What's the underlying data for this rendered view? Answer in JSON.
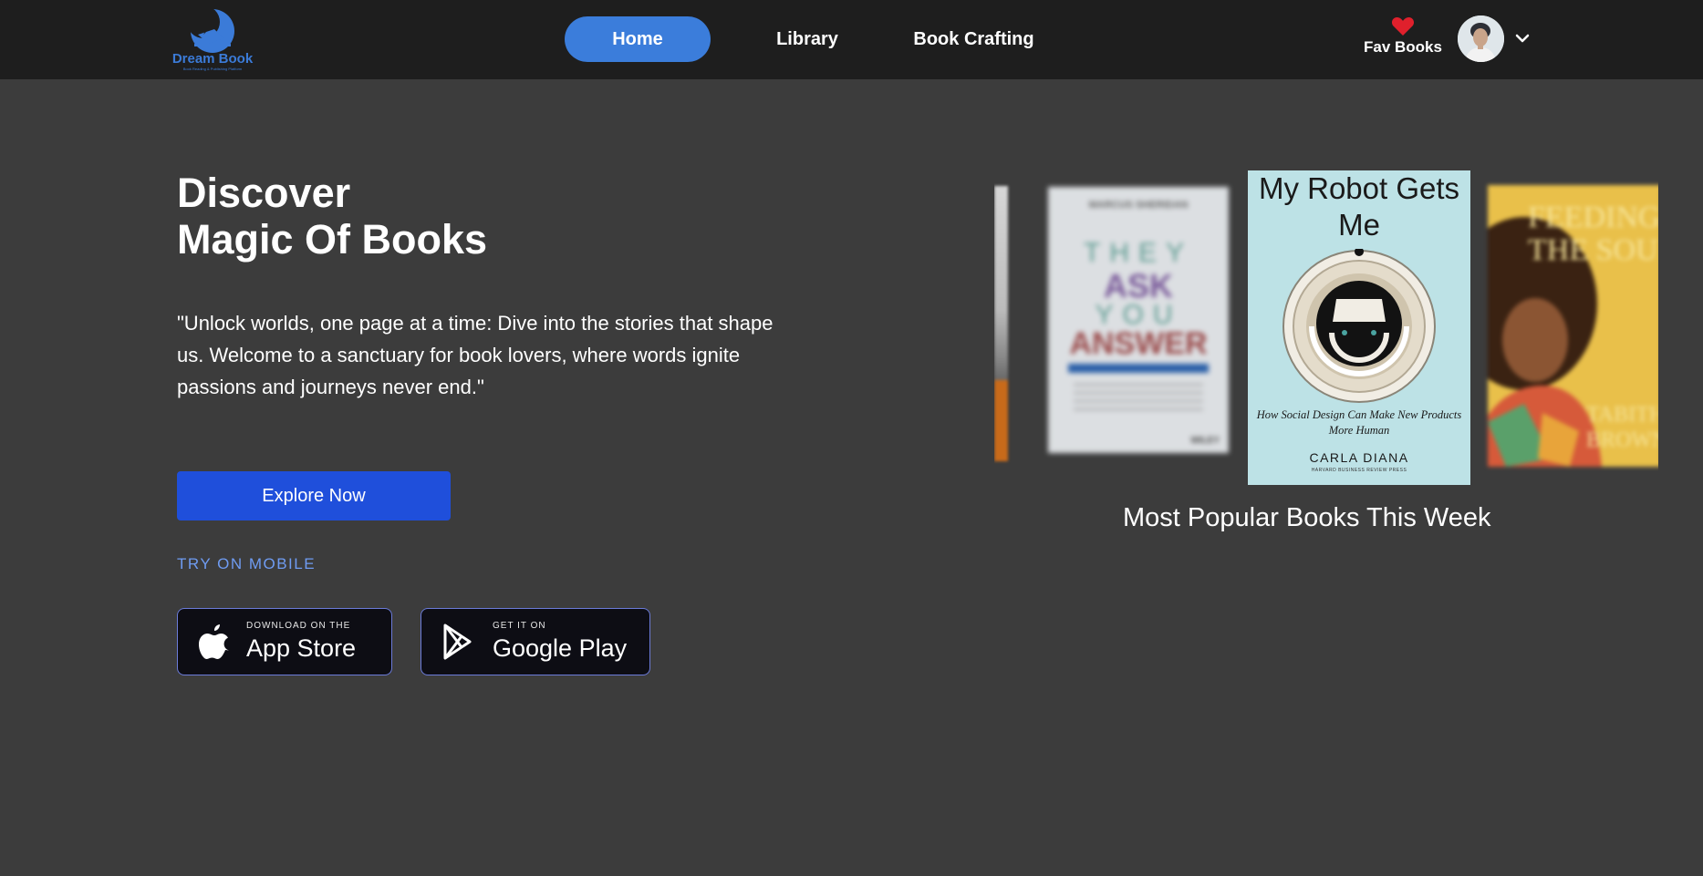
{
  "brand": {
    "name": "Dream Book",
    "tagline": "Book Reading & Publishing Platform",
    "color": "#3b7bd8"
  },
  "nav": {
    "items": [
      {
        "label": "Home",
        "active": true
      },
      {
        "label": "Library",
        "active": false
      },
      {
        "label": "Book Crafting",
        "active": false
      }
    ],
    "active_color": "#3b7ddb"
  },
  "header_right": {
    "fav_label": "Fav Books",
    "fav_icon": "heart-icon",
    "fav_icon_color": "#e0202c",
    "avatar_icon": "user-avatar",
    "menu_icon": "chevron-down-icon"
  },
  "hero": {
    "title_line1": "Discover",
    "title_line2": "Magic Of Books",
    "quote": "\"Unlock worlds, one page at a time: Dive into the stories that shape us. Welcome to a sanctuary for book lovers, where words ignite passions and journeys never end.\"",
    "cta_label": "Explore Now",
    "cta_color": "#1f4fdb"
  },
  "mobile": {
    "heading": "TRY ON MOBILE",
    "heading_color": "#6f9cf2",
    "app_store": {
      "small": "DOWNLOAD ON THE",
      "big": "App Store",
      "icon": "apple-icon"
    },
    "google_play": {
      "small": "GET IT ON",
      "big": "Google Play",
      "icon": "play-store-icon"
    }
  },
  "carousel": {
    "heading": "Most Popular Books This Week",
    "books": [
      {
        "position": "left",
        "author": "MARCUS SHERIDAN",
        "title_parts": [
          "THEY",
          "ASK",
          "YOU",
          "ANSWER"
        ],
        "publisher": "WILEY"
      },
      {
        "position": "center",
        "title": "My Robot Gets Me",
        "subtitle": "How Social Design Can Make New Products More Human",
        "author": "CARLA DIANA",
        "publisher": "HARVARD BUSINESS REVIEW PRESS"
      },
      {
        "position": "right",
        "title": "FEEDING THE SOUL",
        "author": "TABITHA BROWN"
      }
    ]
  }
}
